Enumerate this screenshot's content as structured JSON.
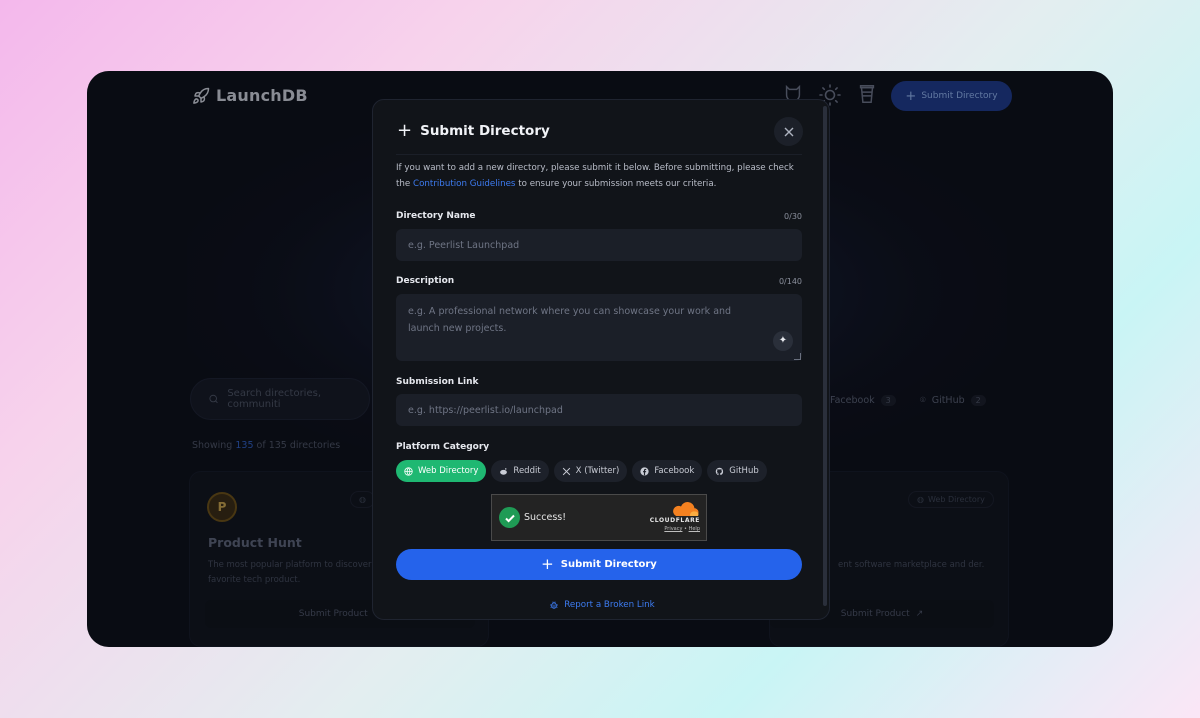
{
  "app": {
    "name": "LaunchDB"
  },
  "header": {
    "submit_label": "Submit Directory"
  },
  "background": {
    "search_placeholder": "Search directories, communiti",
    "filters": [
      {
        "label": "Facebook",
        "count": "3"
      },
      {
        "label": "GitHub",
        "count": "2"
      }
    ],
    "showing": {
      "prefix": "Showing",
      "shown": "135",
      "suffix": "of 135 directories"
    },
    "cards": [
      {
        "title": "Product Hunt",
        "description": "The most popular platform to discover favorite tech product.",
        "button": "Submit Product",
        "tag": ""
      },
      {
        "title": "",
        "description": "ent software marketplace and der.",
        "button": "Submit Product",
        "tag": "Web Directory"
      }
    ]
  },
  "modal": {
    "title": "Submit Directory",
    "intro_text": "If you want to add a new directory, please submit it below. Before submitting, please check the",
    "intro_link": "Contribution Guidelines",
    "intro_end": "to ensure your submission meets our criteria.",
    "name": {
      "label": "Directory Name",
      "counter": "0/30",
      "placeholder": "e.g. Peerlist Launchpad"
    },
    "description": {
      "label": "Description",
      "counter": "0/140",
      "placeholder": "e.g. A professional network where you can showcase your work and launch new projects."
    },
    "link": {
      "label": "Submission Link",
      "placeholder": "e.g. https://peerlist.io/launchpad"
    },
    "category": {
      "label": "Platform Category",
      "options": [
        {
          "label": "Web Directory",
          "icon": "globe-icon",
          "active": true
        },
        {
          "label": "Reddit",
          "icon": "reddit-icon",
          "active": false
        },
        {
          "label": "X (Twitter)",
          "icon": "x-icon",
          "active": false
        },
        {
          "label": "Facebook",
          "icon": "facebook-icon",
          "active": false
        },
        {
          "label": "GitHub",
          "icon": "github-icon",
          "active": false
        }
      ]
    },
    "captcha": {
      "status": "Success!",
      "brand": "CLOUDFLARE",
      "privacy": "Privacy",
      "separator": "•",
      "help": "Help"
    },
    "submit_label": "Submit Directory",
    "broken_link_label": "Report a Broken Link"
  },
  "colors": {
    "accent": "#2563eb",
    "success": "#1fb872",
    "link": "#3d7bf0"
  }
}
